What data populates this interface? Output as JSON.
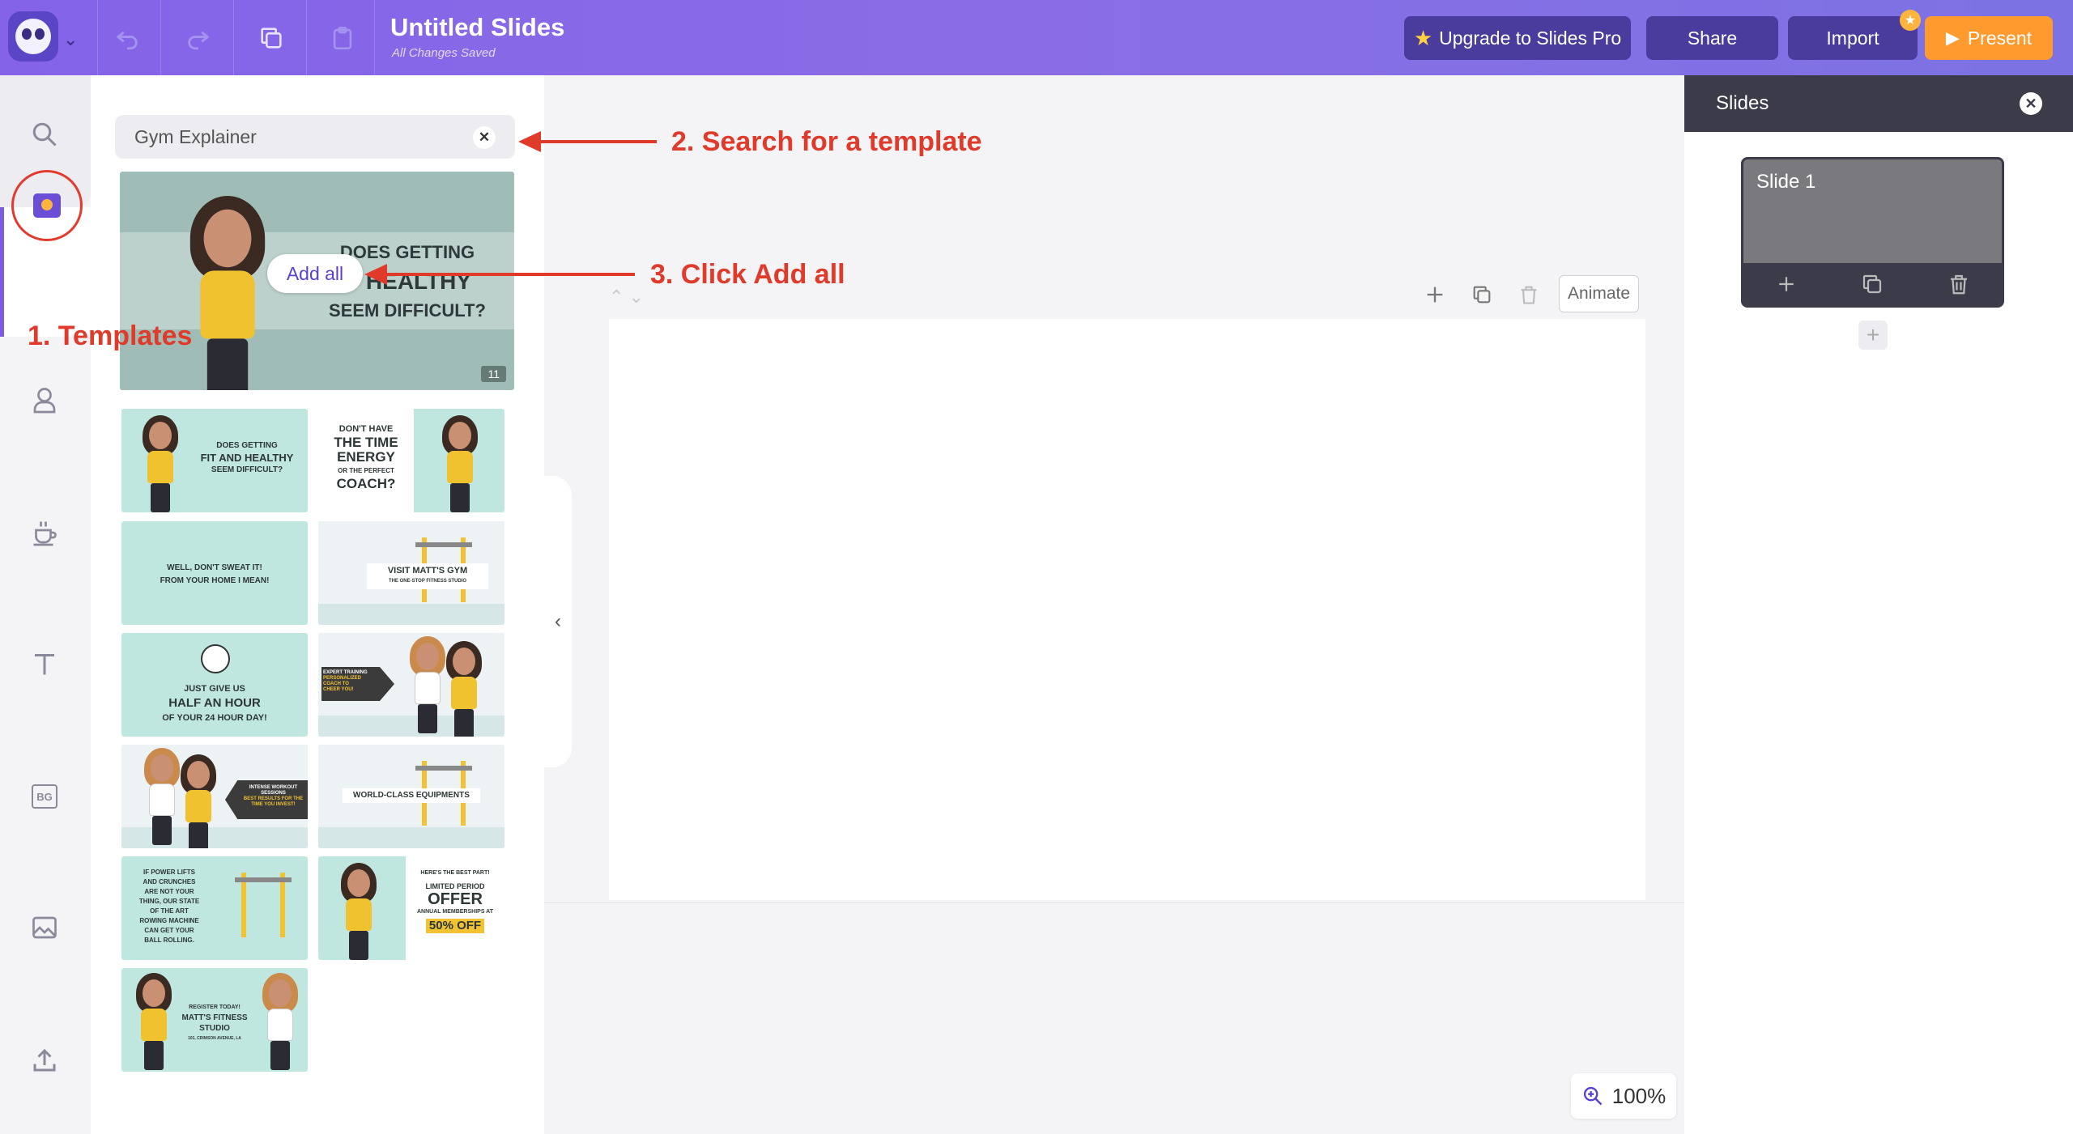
{
  "header": {
    "title": "Untitled Slides",
    "save_state": "All Changes Saved",
    "upgrade_label": "Upgrade to Slides Pro",
    "share_label": "Share",
    "import_label": "Import",
    "present_label": "Present",
    "accent_color": "#8463e8",
    "present_color": "#ff9a2e"
  },
  "rail": {
    "items": [
      "search-icon",
      "templates-icon",
      "character-icon",
      "props-icon",
      "text-icon",
      "background-icon",
      "image-icon",
      "upload-icon"
    ],
    "bg_label": "BG"
  },
  "templates": {
    "search_value": "Gym Explainer",
    "hero": {
      "line1": "DOES GETTING",
      "line2": "D HEALTHY",
      "line3": "SEEM DIFFICULT?",
      "count": "11"
    },
    "add_all_label": "Add all",
    "thumbs": [
      {
        "lines": [
          "DOES GETTING",
          "FIT AND HEALTHY",
          "SEEM DIFFICULT?"
        ]
      },
      {
        "lines": [
          "DON'T HAVE",
          "THE TIME",
          "ENERGY",
          "OR THE PERFECT",
          "COACH?"
        ]
      },
      {
        "lines": [
          "WELL, DON'T SWEAT IT!",
          "FROM YOUR HOME I MEAN!"
        ]
      },
      {
        "lines": [
          "VISIT MATT'S GYM",
          "THE ONE-STOP FITNESS STUDIO"
        ]
      },
      {
        "lines": [
          "JUST GIVE US",
          "HALF AN HOUR",
          "OF YOUR 24 HOUR DAY!"
        ]
      },
      {
        "lines": [
          "EXPERT TRAINING",
          "PERSONALIZED",
          "COACH TO",
          "CHEER YOU!"
        ]
      },
      {
        "lines": [
          "INTENSE WORKOUT",
          "SESSIONS",
          "BEST RESULTS FOR THE",
          "TIME YOU INVEST!"
        ]
      },
      {
        "lines": [
          "WORLD-CLASS EQUIPMENTS"
        ]
      },
      {
        "lines": [
          "IF POWER LIFTS",
          "AND CRUNCHES",
          "ARE NOT YOUR",
          "THING, OUR STATE",
          "OF THE ART",
          "ROWING MACHINE",
          "CAN GET YOUR",
          "BALL ROLLING."
        ]
      },
      {
        "lines": [
          "HERE'S THE BEST PART!",
          "LIMITED PERIOD",
          "OFFER",
          "ANNUAL MEMBERSHIPS AT",
          "50% OFF"
        ]
      },
      {
        "lines": [
          "REGISTER TODAY!",
          "MATT'S FITNESS STUDIO",
          "101, CRIMSON AVENUE, LA"
        ]
      }
    ]
  },
  "canvas": {
    "animate_label": "Animate",
    "zoom": "100%"
  },
  "slides_panel": {
    "title": "Slides",
    "slides": [
      {
        "name": "Slide 1"
      }
    ]
  },
  "annotations": {
    "step1": "1. Templates",
    "step2": "2. Search for a template",
    "step3": "3. Click Add all",
    "color": "#e03a2b"
  }
}
